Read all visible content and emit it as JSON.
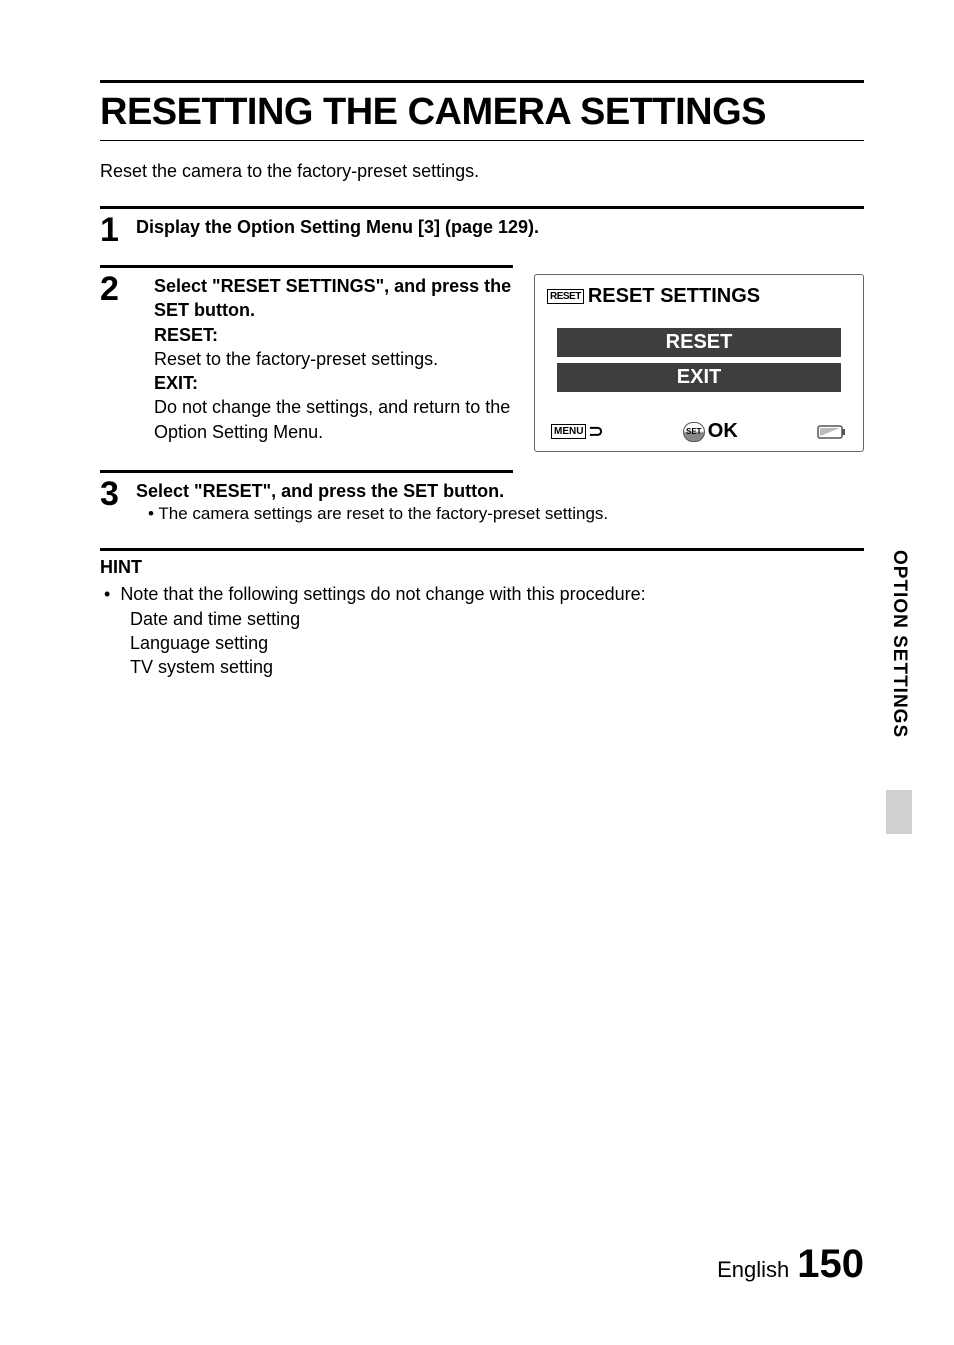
{
  "title": "RESETTING THE CAMERA SETTINGS",
  "intro": "Reset the camera to the factory-preset settings.",
  "steps": [
    {
      "num": "1",
      "instruction": "Display the Option Setting Menu [3] (page 129)."
    },
    {
      "num": "2",
      "instruction": "Select \"RESET SETTINGS\", and press the SET button.",
      "defs": [
        {
          "label": "RESET:",
          "text": "Reset to the factory-preset settings."
        },
        {
          "label": "EXIT:",
          "text": "Do not change the settings, and return to the Option Setting Menu."
        }
      ]
    },
    {
      "num": "3",
      "instruction": "Select \"RESET\", and press the SET button.",
      "bullets": [
        "The camera settings are reset to the factory-preset settings."
      ]
    }
  ],
  "camera_screen": {
    "reset_icon": "RESET",
    "title": "RESET SETTINGS",
    "options": [
      "RESET",
      "EXIT"
    ],
    "footer": {
      "menu_label": "MENU",
      "set_label": "SET",
      "ok_label": "OK"
    }
  },
  "hint": {
    "label": "HINT",
    "bullet": "Note that the following settings do not change with this procedure:",
    "items": [
      "Date and time setting",
      "Language setting",
      "TV system setting"
    ]
  },
  "side_tab": "OPTION SETTINGS",
  "footer": {
    "language": "English",
    "page": "150"
  }
}
